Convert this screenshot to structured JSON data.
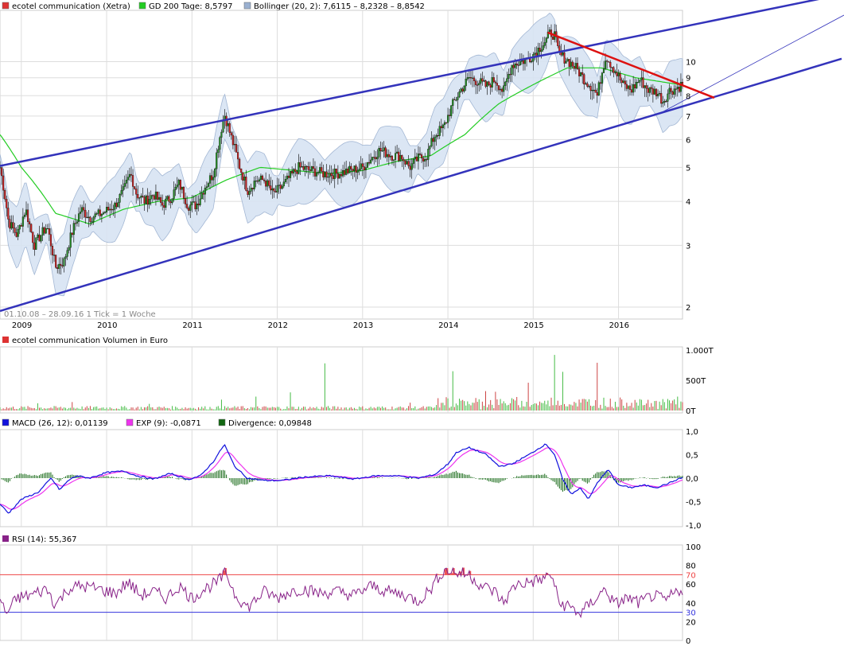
{
  "colors": {
    "price_legend": "#dd3333",
    "sma_line": "#22cc22",
    "bollinger_fill": "#d8e4f3",
    "bollinger_edge": "#9ab0d0",
    "candle_up": "#228822",
    "candle_down": "#cc2222",
    "channel": "#3333bb",
    "trendline": "#dd1111",
    "macd": "#1111dd",
    "signal": "#ee33ee",
    "divergence": "#116611",
    "rsi": "#882288",
    "rsi_fill": "#ee5555",
    "rsi_upper": "#ee4444",
    "rsi_lower": "#3333dd",
    "volume_up": "#44bb44",
    "volume_down": "#cc4444",
    "grid": "#dddddd"
  },
  "chart_data": [
    {
      "type": "candlestick",
      "panel": "price",
      "title": "ecotel communication (Xetra)",
      "legend": [
        {
          "label": "ecotel communication (Xetra)",
          "color": "#dd3333"
        },
        {
          "label": "GD 200 Tage: 8,5797",
          "color": "#22cc22"
        },
        {
          "label": "Bollinger (20, 2): 7,6115 – 8,2328 – 8,8542",
          "color": "#9ab0d0"
        }
      ],
      "date_range_label": "01.10.08 – 28.09.16   1 Tick = 1 Woche",
      "y_scale": "log",
      "ylim": [
        1.85,
        14
      ],
      "y_ticks": [
        2,
        3,
        4,
        5,
        6,
        7,
        8,
        9,
        10
      ],
      "x_ticks": [
        "2009",
        "2010",
        "2011",
        "2012",
        "2013",
        "2014",
        "2015",
        "2016"
      ],
      "xlim": [
        2008.75,
        2016.75
      ],
      "close_anchors": [
        [
          2008.75,
          5.0
        ],
        [
          2008.85,
          3.5
        ],
        [
          2008.95,
          3.2
        ],
        [
          2009.05,
          3.8
        ],
        [
          2009.15,
          3.0
        ],
        [
          2009.3,
          3.4
        ],
        [
          2009.4,
          2.6
        ],
        [
          2009.5,
          2.7
        ],
        [
          2009.6,
          3.3
        ],
        [
          2009.7,
          3.8
        ],
        [
          2009.8,
          3.6
        ],
        [
          2009.95,
          3.7
        ],
        [
          2010.1,
          3.9
        ],
        [
          2010.2,
          4.3
        ],
        [
          2010.28,
          4.8
        ],
        [
          2010.35,
          4.2
        ],
        [
          2010.45,
          4.0
        ],
        [
          2010.55,
          4.2
        ],
        [
          2010.65,
          3.9
        ],
        [
          2010.75,
          4.1
        ],
        [
          2010.85,
          4.5
        ],
        [
          2010.95,
          3.9
        ],
        [
          2011.05,
          3.9
        ],
        [
          2011.15,
          4.4
        ],
        [
          2011.25,
          4.8
        ],
        [
          2011.32,
          6.0
        ],
        [
          2011.38,
          7.1
        ],
        [
          2011.45,
          6.2
        ],
        [
          2011.55,
          5.1
        ],
        [
          2011.65,
          4.3
        ],
        [
          2011.75,
          4.6
        ],
        [
          2011.85,
          4.6
        ],
        [
          2011.95,
          4.2
        ],
        [
          2012.05,
          4.4
        ],
        [
          2012.15,
          4.7
        ],
        [
          2012.25,
          5.0
        ],
        [
          2012.4,
          4.9
        ],
        [
          2012.55,
          4.8
        ],
        [
          2012.7,
          4.8
        ],
        [
          2012.85,
          4.9
        ],
        [
          2013.0,
          5.0
        ],
        [
          2013.1,
          5.3
        ],
        [
          2013.2,
          5.6
        ],
        [
          2013.35,
          5.4
        ],
        [
          2013.45,
          5.4
        ],
        [
          2013.55,
          5.0
        ],
        [
          2013.65,
          5.3
        ],
        [
          2013.75,
          5.4
        ],
        [
          2013.85,
          6.2
        ],
        [
          2013.95,
          6.5
        ],
        [
          2014.05,
          7.5
        ],
        [
          2014.15,
          8.3
        ],
        [
          2014.25,
          9.0
        ],
        [
          2014.35,
          8.8
        ],
        [
          2014.45,
          8.5
        ],
        [
          2014.55,
          8.9
        ],
        [
          2014.65,
          8.2
        ],
        [
          2014.75,
          9.8
        ],
        [
          2014.85,
          10.0
        ],
        [
          2014.95,
          10.2
        ],
        [
          2015.05,
          10.8
        ],
        [
          2015.15,
          11.5
        ],
        [
          2015.2,
          12.1
        ],
        [
          2015.25,
          11.9
        ],
        [
          2015.3,
          10.5
        ],
        [
          2015.4,
          10.1
        ],
        [
          2015.5,
          9.6
        ],
        [
          2015.6,
          8.9
        ],
        [
          2015.7,
          8.4
        ],
        [
          2015.75,
          8.0
        ],
        [
          2015.85,
          10.4
        ],
        [
          2015.95,
          9.5
        ],
        [
          2016.05,
          8.6
        ],
        [
          2016.15,
          8.3
        ],
        [
          2016.25,
          8.9
        ],
        [
          2016.35,
          8.3
        ],
        [
          2016.45,
          8.2
        ],
        [
          2016.52,
          7.7
        ],
        [
          2016.6,
          8.3
        ],
        [
          2016.68,
          8.4
        ],
        [
          2016.74,
          8.6
        ]
      ],
      "sma200_anchors": [
        [
          2008.75,
          6.2
        ],
        [
          2009.0,
          5.0
        ],
        [
          2009.4,
          3.7
        ],
        [
          2009.8,
          3.45
        ],
        [
          2010.2,
          3.8
        ],
        [
          2010.6,
          4.0
        ],
        [
          2011.0,
          4.1
        ],
        [
          2011.4,
          4.6
        ],
        [
          2011.8,
          5.0
        ],
        [
          2012.2,
          4.9
        ],
        [
          2012.6,
          4.8
        ],
        [
          2013.0,
          4.9
        ],
        [
          2013.4,
          5.2
        ],
        [
          2013.8,
          5.4
        ],
        [
          2014.2,
          6.2
        ],
        [
          2014.6,
          7.6
        ],
        [
          2015.0,
          8.6
        ],
        [
          2015.4,
          9.6
        ],
        [
          2015.8,
          9.6
        ],
        [
          2016.2,
          9.0
        ],
        [
          2016.74,
          8.58
        ]
      ],
      "bollinger_band_width_pct": 15,
      "channel_upper": {
        "from": [
          2008.75,
          5.05
        ],
        "to": [
          2016.75,
          14.0
        ]
      },
      "channel_lower": {
        "from": [
          2008.75,
          1.95
        ],
        "to": [
          2016.75,
          7.65
        ]
      },
      "channel_extension": [
        [
          2016.52,
          7.2
        ],
        [
          2016.75,
          7.65
        ]
      ],
      "trendline": {
        "from": [
          2015.17,
          12.1
        ],
        "to": [
          2016.75,
          8.1
        ]
      }
    },
    {
      "type": "bar",
      "panel": "volume",
      "title": "ecotel communication Volumen in Euro",
      "y_ticks": [
        "1.000T",
        "500T",
        "0T"
      ],
      "ylim": [
        0,
        1000
      ],
      "unit": "T",
      "peaks": [
        [
          2009.2,
          120
        ],
        [
          2009.6,
          140
        ],
        [
          2010.5,
          110
        ],
        [
          2011.35,
          180
        ],
        [
          2011.75,
          230
        ],
        [
          2012.15,
          300
        ],
        [
          2012.55,
          780
        ],
        [
          2013.55,
          130
        ],
        [
          2014.0,
          200
        ],
        [
          2014.05,
          650
        ],
        [
          2014.45,
          320
        ],
        [
          2014.55,
          310
        ],
        [
          2014.95,
          460
        ],
        [
          2015.25,
          920
        ],
        [
          2015.35,
          640
        ],
        [
          2015.75,
          790
        ],
        [
          2016.45,
          160
        ],
        [
          2016.7,
          230
        ]
      ]
    },
    {
      "type": "line",
      "panel": "macd",
      "series": [
        {
          "name": "MACD (26, 12): 0,01139",
          "color": "#1111dd"
        },
        {
          "name": "EXP (9): -0,0871",
          "color": "#ee33ee"
        },
        {
          "name": "Divergence: 0,09848",
          "color": "#116611"
        }
      ],
      "ylim": [
        -1.0,
        1.0
      ],
      "y_ticks": [
        "1,0",
        "0,5",
        "0,0",
        "-0,5",
        "-1,0"
      ],
      "macd_anchors": [
        [
          2008.75,
          -0.55
        ],
        [
          2008.85,
          -0.75
        ],
        [
          2009.0,
          -0.45
        ],
        [
          2009.2,
          -0.3
        ],
        [
          2009.35,
          0.0
        ],
        [
          2009.45,
          -0.25
        ],
        [
          2009.55,
          -0.05
        ],
        [
          2009.65,
          0.05
        ],
        [
          2009.8,
          0.0
        ],
        [
          2010.0,
          0.12
        ],
        [
          2010.2,
          0.15
        ],
        [
          2010.35,
          0.05
        ],
        [
          2010.55,
          -0.02
        ],
        [
          2010.75,
          0.1
        ],
        [
          2010.95,
          -0.03
        ],
        [
          2011.1,
          0.05
        ],
        [
          2011.25,
          0.35
        ],
        [
          2011.38,
          0.72
        ],
        [
          2011.5,
          0.25
        ],
        [
          2011.65,
          0.0
        ],
        [
          2011.85,
          -0.05
        ],
        [
          2012.05,
          -0.05
        ],
        [
          2012.3,
          0.02
        ],
        [
          2012.6,
          0.05
        ],
        [
          2012.9,
          -0.02
        ],
        [
          2013.15,
          0.05
        ],
        [
          2013.4,
          0.05
        ],
        [
          2013.65,
          0.0
        ],
        [
          2013.85,
          0.08
        ],
        [
          2014.0,
          0.3
        ],
        [
          2014.1,
          0.55
        ],
        [
          2014.25,
          0.65
        ],
        [
          2014.45,
          0.5
        ],
        [
          2014.6,
          0.25
        ],
        [
          2014.75,
          0.3
        ],
        [
          2014.95,
          0.5
        ],
        [
          2015.15,
          0.73
        ],
        [
          2015.25,
          0.5
        ],
        [
          2015.35,
          -0.05
        ],
        [
          2015.45,
          -0.35
        ],
        [
          2015.55,
          -0.2
        ],
        [
          2015.65,
          -0.45
        ],
        [
          2015.75,
          -0.1
        ],
        [
          2015.88,
          0.18
        ],
        [
          2016.0,
          -0.15
        ],
        [
          2016.15,
          -0.2
        ],
        [
          2016.3,
          -0.15
        ],
        [
          2016.45,
          -0.2
        ],
        [
          2016.6,
          -0.1
        ],
        [
          2016.74,
          0.01
        ]
      ]
    },
    {
      "type": "line",
      "panel": "rsi",
      "series": [
        {
          "name": "RSI (14): 55,367",
          "color": "#882288"
        }
      ],
      "ylim": [
        0,
        100
      ],
      "y_ticks": [
        "100",
        "80",
        "60",
        "40",
        "20",
        "0"
      ],
      "upper_level": {
        "value": 70,
        "label": "70"
      },
      "lower_level": {
        "value": 30,
        "label": "30"
      },
      "rsi_anchors": [
        [
          2008.75,
          45
        ],
        [
          2008.82,
          28
        ],
        [
          2008.95,
          45
        ],
        [
          2009.1,
          48
        ],
        [
          2009.3,
          55
        ],
        [
          2009.4,
          38
        ],
        [
          2009.55,
          55
        ],
        [
          2009.7,
          58
        ],
        [
          2009.9,
          55
        ],
        [
          2010.1,
          50
        ],
        [
          2010.25,
          62
        ],
        [
          2010.4,
          48
        ],
        [
          2010.55,
          52
        ],
        [
          2010.7,
          45
        ],
        [
          2010.85,
          58
        ],
        [
          2011.0,
          45
        ],
        [
          2011.15,
          55
        ],
        [
          2011.3,
          62
        ],
        [
          2011.4,
          72
        ],
        [
          2011.5,
          50
        ],
        [
          2011.65,
          35
        ],
        [
          2011.85,
          52
        ],
        [
          2012.0,
          45
        ],
        [
          2012.15,
          52
        ],
        [
          2012.3,
          55
        ],
        [
          2012.5,
          50
        ],
        [
          2012.7,
          52
        ],
        [
          2012.9,
          48
        ],
        [
          2013.1,
          58
        ],
        [
          2013.3,
          52
        ],
        [
          2013.5,
          48
        ],
        [
          2013.65,
          42
        ],
        [
          2013.8,
          55
        ],
        [
          2013.92,
          72
        ],
        [
          2014.0,
          75
        ],
        [
          2014.1,
          72
        ],
        [
          2014.25,
          70
        ],
        [
          2014.4,
          58
        ],
        [
          2014.55,
          52
        ],
        [
          2014.65,
          40
        ],
        [
          2014.8,
          60
        ],
        [
          2014.95,
          62
        ],
        [
          2015.1,
          65
        ],
        [
          2015.22,
          70
        ],
        [
          2015.3,
          40
        ],
        [
          2015.45,
          35
        ],
        [
          2015.55,
          28
        ],
        [
          2015.7,
          42
        ],
        [
          2015.85,
          55
        ],
        [
          2015.95,
          38
        ],
        [
          2016.1,
          45
        ],
        [
          2016.25,
          40
        ],
        [
          2016.4,
          48
        ],
        [
          2016.55,
          42
        ],
        [
          2016.65,
          50
        ],
        [
          2016.74,
          55
        ]
      ]
    }
  ]
}
